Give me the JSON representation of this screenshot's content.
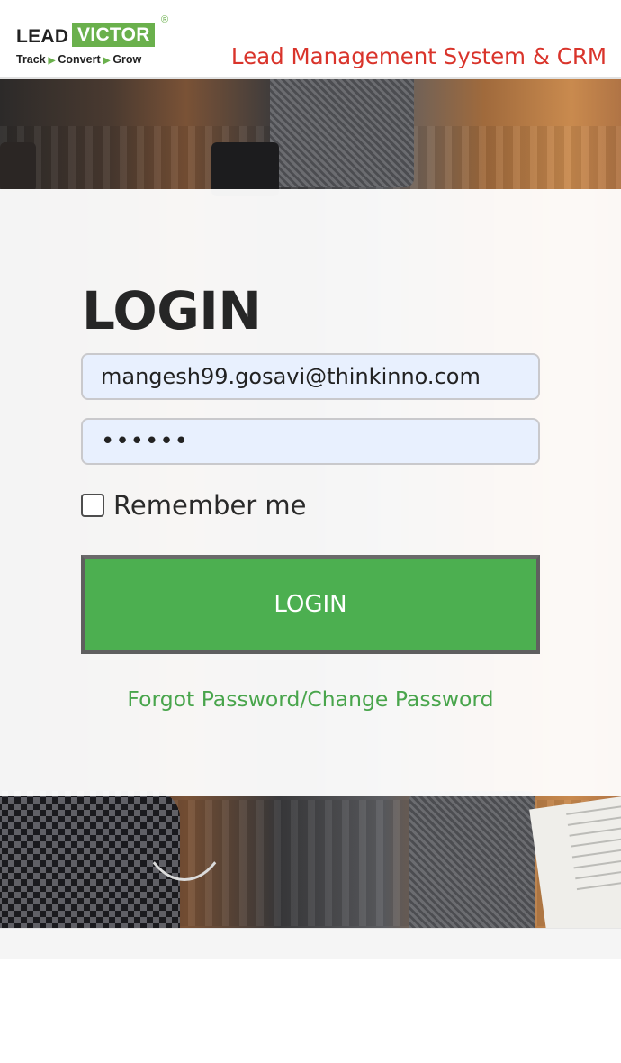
{
  "brand": {
    "logo_word1": "LEAD",
    "logo_word2": "VICTOR",
    "logo_reg": "®",
    "tagline": [
      "Track",
      "Convert",
      "Grow"
    ],
    "accent_color": "#6ab04c"
  },
  "header": {
    "title": "Lead Management System & CRM",
    "title_color": "#d9342b"
  },
  "login": {
    "heading": "LOGIN",
    "email_value": "mangesh99.gosavi@thinkinno.com",
    "password_value": "••••••",
    "remember_label": "Remember me",
    "remember_checked": false,
    "submit_label": "LOGIN",
    "forgot_link": "Forgot Password/Change Password",
    "button_color": "#4caf50"
  }
}
